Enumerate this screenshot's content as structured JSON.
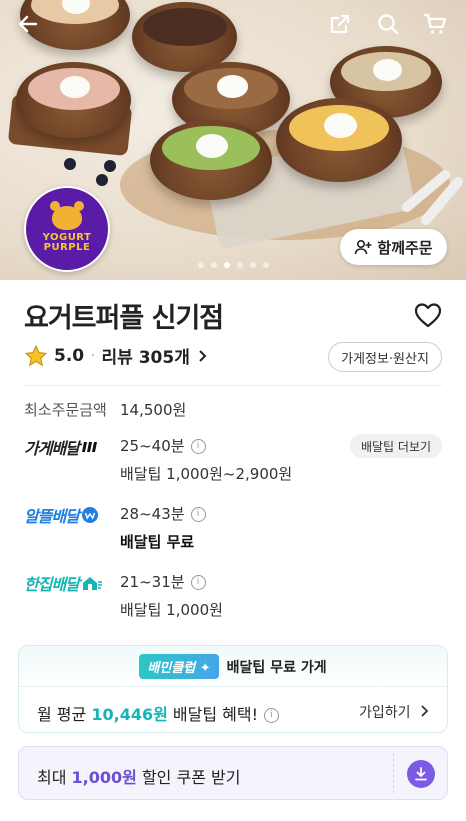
{
  "header": {
    "back_icon": "back-arrow-icon",
    "share_icon": "share-icon",
    "search_icon": "search-icon",
    "cart_icon": "cart-icon"
  },
  "hero": {
    "logo_line1": "YOGURT",
    "logo_line2": "PURPLE",
    "together_order_label": "함께주문",
    "carousel_total": 6,
    "carousel_active": 3
  },
  "store": {
    "name": "요거트퍼플 신기점",
    "rating": "5.0",
    "reviews_label": "리뷰 305개",
    "info_button": "가게정보·원산지"
  },
  "details": {
    "min_order_label": "최소주문금액",
    "min_order_value": "14,500원",
    "delivery": [
      {
        "name": "가게배달",
        "time": "25~40분",
        "tip": "배달팁 1,000원~2,900원",
        "more": "배달팁 더보기",
        "color": "#111111"
      },
      {
        "name": "알뜰배달",
        "time": "28~43분",
        "tip": "배달팁 무료",
        "color": "#1f7fe0"
      },
      {
        "name": "한집배달",
        "time": "21~31분",
        "tip": "배달팁 1,000원",
        "color": "#17b4b4"
      }
    ]
  },
  "club": {
    "badge": "배민클럽",
    "headline": "배달팁 무료 가게",
    "text_prefix": "월 평균 ",
    "amount": "10,446원",
    "text_suffix": " 배달팁 혜택!",
    "join_label": "가입하기"
  },
  "coupon": {
    "prefix": "최대 ",
    "amount": "1,000원",
    "suffix": " 할인 쿠폰 받기"
  },
  "colors": {
    "accent_mint": "#17b4b4",
    "accent_purple": "#7b5be6"
  }
}
